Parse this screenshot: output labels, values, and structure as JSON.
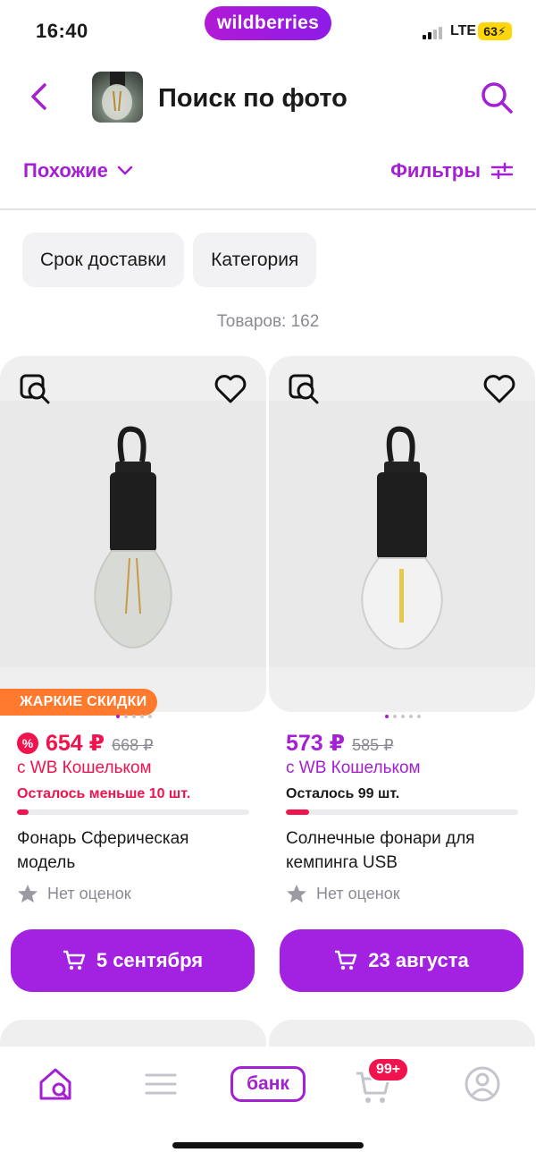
{
  "status_bar": {
    "time": "16:40",
    "brand": "wildberries",
    "network": "LTE",
    "battery": "63"
  },
  "header": {
    "title": "Поиск по фото",
    "back_icon": "chevron-left-icon",
    "search_icon": "search-icon"
  },
  "toolbar": {
    "similar_label": "Похожие",
    "filters_label": "Фильтры"
  },
  "chips": [
    {
      "label": "Срок доставки"
    },
    {
      "label": "Категория"
    }
  ],
  "results_count": "Товаров: 162",
  "products": [
    {
      "badge": "ЖАРКИЕ СКИДКИ",
      "price": "654 ₽",
      "old_price": "668 ₽",
      "wallet_label": "с WB Кошельком",
      "stock_label": "Осталось меньше 10 шт.",
      "stock_level": 0.05,
      "name": "Фонарь Сферическая модель",
      "rating_label": "Нет оценок",
      "delivery_label": "5 сентября",
      "images": 5,
      "active_image": 0
    },
    {
      "badge": "",
      "price": "573 ₽",
      "old_price": "585 ₽",
      "wallet_label": "с WB Кошельком",
      "stock_label": "Осталось 99 шт.",
      "stock_level": 0.1,
      "name": "Солнечные фонари для кемпинга USB",
      "rating_label": "Нет оценок",
      "delivery_label": "23 августа",
      "images": 5,
      "active_image": 0
    }
  ],
  "bottom_nav": {
    "bank_label": "банк",
    "cart_badge": "99+"
  },
  "colors": {
    "accent": "#a321d2",
    "sale": "#f0134d",
    "hot": "#ff7a2e"
  }
}
